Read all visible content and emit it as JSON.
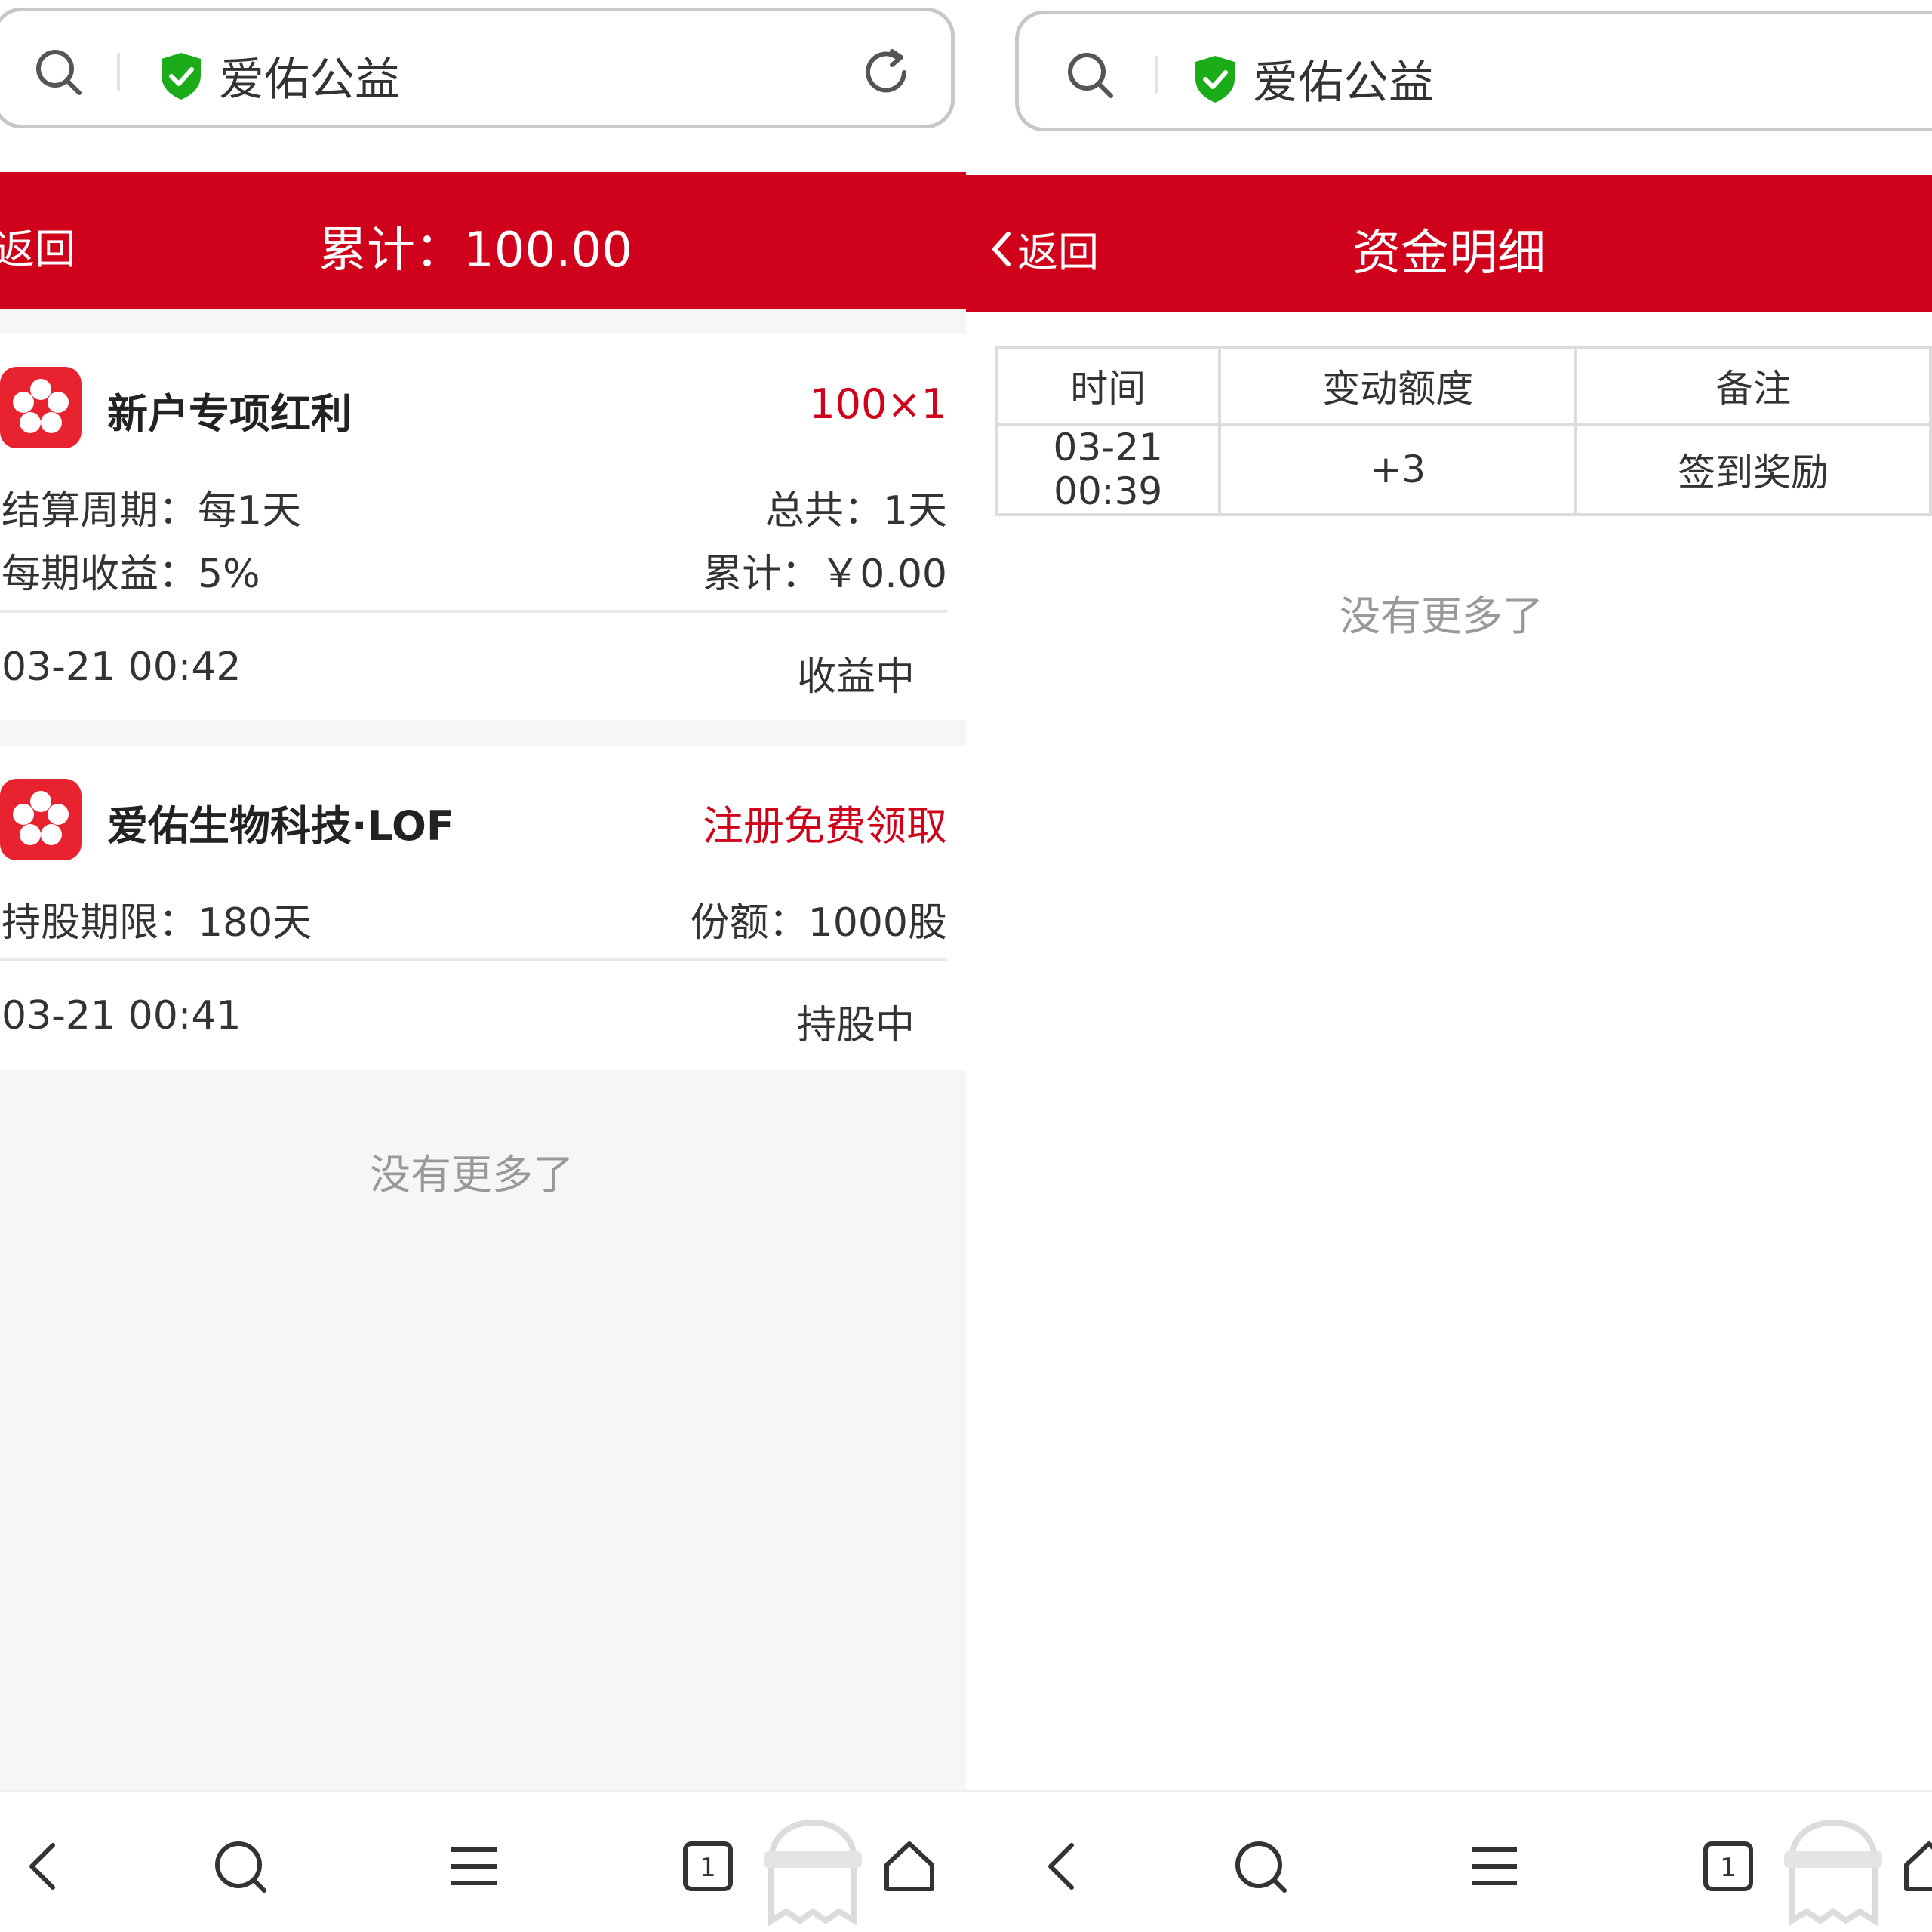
{
  "left": {
    "address_bar": {
      "title": "爱佑公益"
    },
    "header": {
      "back_label": "返回",
      "title": "累计：100.00"
    },
    "cards": [
      {
        "name": "新户专项红利",
        "tag": "100×1",
        "rows": [
          {
            "left": "结算周期：每1天",
            "right": "总共：1天"
          },
          {
            "left": "每期收益：5%",
            "right": "累计：￥0.00"
          }
        ],
        "time": "03-21 00:42",
        "status": "收益中"
      },
      {
        "name": "爱佑生物科技·LOF",
        "tag": "注册免费领取",
        "rows": [
          {
            "left": "持股期限：180天",
            "right": "份额：1000股"
          }
        ],
        "time": "03-21 00:41",
        "status": "持股中"
      }
    ],
    "no_more": "没有更多了",
    "toolbar": {
      "tabs_count": "1"
    }
  },
  "right": {
    "address_bar": {
      "title": "爱佑公益"
    },
    "header": {
      "back_label": "返回",
      "title": "资金明细"
    },
    "table": {
      "headers": [
        "时间",
        "变动额度",
        "备注"
      ],
      "rows": [
        [
          "03-21 00:39",
          "+3",
          "签到奖励"
        ]
      ]
    },
    "no_more": "没有更多了",
    "toolbar": {
      "tabs_count": "1"
    }
  },
  "colors": {
    "brand_red": "#d0021b",
    "shield_green": "#1aad19"
  },
  "icons": [
    "search-icon",
    "shield-check-icon",
    "reload-icon",
    "back-chevron-icon",
    "flower-logo-icon",
    "back-arrow-icon",
    "menu-icon",
    "tabs-icon",
    "home-icon",
    "ghost-mascot-icon"
  ]
}
